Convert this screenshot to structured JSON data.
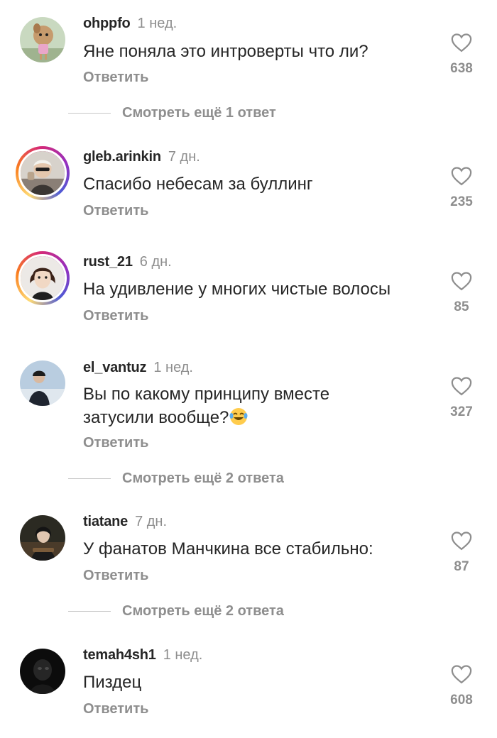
{
  "reply_label": "Ответить",
  "comments": [
    {
      "username": "ohppfo",
      "time": "1 нед.",
      "text": "Яне поняла это интроверты что ли?",
      "likes": "638",
      "more": "Смотреть ещё 1 ответ",
      "has_story": false
    },
    {
      "username": "gleb.arinkin",
      "time": "7 дн.",
      "text": "Спасибо небесам за буллинг",
      "likes": "235",
      "has_story": true
    },
    {
      "username": "rust_21",
      "time": "6 дн.",
      "text": "На удивление у многих чистые волосы",
      "likes": "85",
      "has_story": true
    },
    {
      "username": "el_vantuz",
      "time": "1 нед.",
      "text_line1": "Вы по какому принципу вместе",
      "text_line2": "затусили вообще?",
      "emoji": "rolling-on-floor-laughing-emoji",
      "likes": "327",
      "more": "Смотреть ещё 2 ответа",
      "has_story": false
    },
    {
      "username": "tiatane",
      "time": "7 дн.",
      "text": "У фанатов Манчкина все стабильно:",
      "likes": "87",
      "more": "Смотреть ещё 2 ответа",
      "has_story": false
    },
    {
      "username": "temah4sh1",
      "time": "1 нед.",
      "text": "Пиздец",
      "likes": "608",
      "has_story": false
    }
  ],
  "colors": {
    "text": "#262626",
    "secondary": "#8e8e8e",
    "divider": "#c7c7c7",
    "background": "#ffffff"
  }
}
